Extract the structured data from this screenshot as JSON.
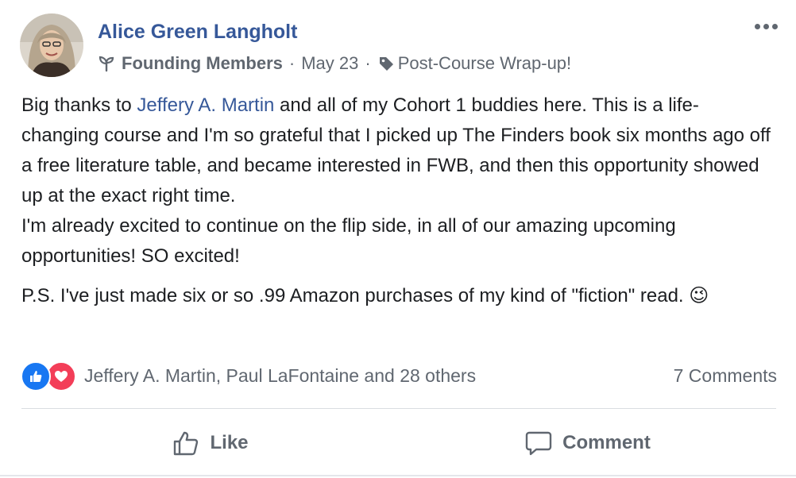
{
  "post": {
    "author": "Alice Green Langholt",
    "group": "Founding Members",
    "separator": "·",
    "date": "May 23",
    "topic": "Post-Course Wrap-up!",
    "body": {
      "p1_before_mention": "Big thanks to ",
      "mention": "Jeffery A. Martin",
      "p1_after_mention": " and all of my Cohort 1 buddies here. This is a life-changing course and I'm so grateful that I picked up The Finders book six months ago off a free literature table, and became interested in FWB, and then this opportunity showed up at the exact right time.",
      "p1_line2": "I'm already excited to continue on the flip side, in all of our amazing upcoming opportunities! SO excited!",
      "p2": "P.S. I've just made six or so .99 Amazon purchases of my kind of \"fiction\" read.",
      "emoji": "😉"
    },
    "reactions": {
      "names": "Jeffery A. Martin, Paul LaFontaine and 28 others",
      "comments": "7 Comments",
      "types": [
        "like-icon",
        "love-icon"
      ]
    },
    "actions": {
      "like": "Like",
      "comment": "Comment"
    }
  },
  "colors": {
    "link": "#365899",
    "secondary_text": "#606770",
    "like_blue": "#1877f2",
    "love_red": "#f33e58"
  }
}
